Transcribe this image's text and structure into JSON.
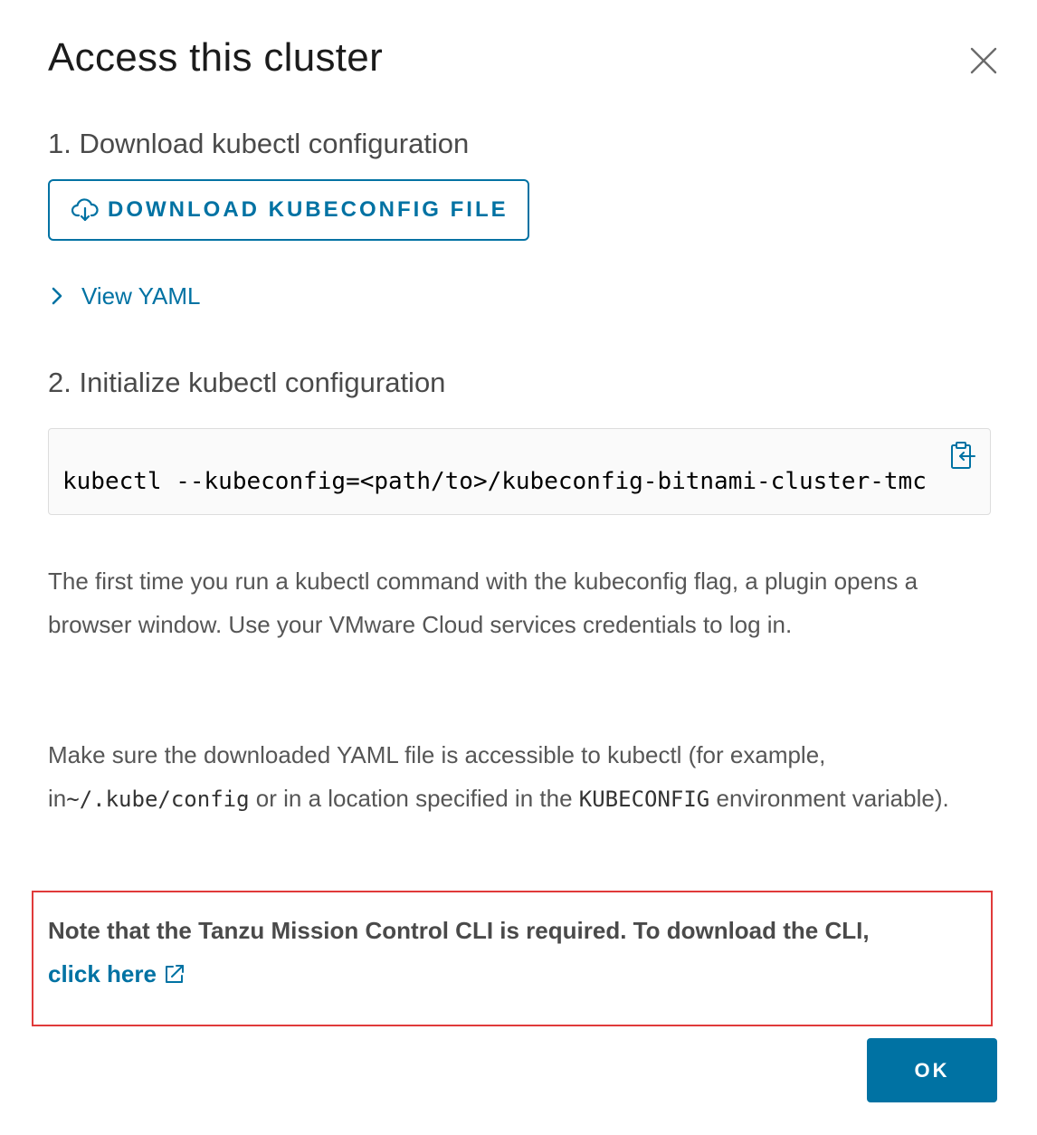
{
  "dialog": {
    "title": "Access this cluster",
    "close_icon": "close-icon"
  },
  "step1": {
    "heading": "1. Download kubectl configuration",
    "download_button": {
      "label": "DOWNLOAD KUBECONFIG FILE",
      "icon": "cloud-download-icon"
    },
    "view_yaml": {
      "label": "View YAML",
      "icon": "chevron-right-icon"
    }
  },
  "step2": {
    "heading": "2. Initialize kubectl configuration",
    "command": "kubectl --kubeconfig=<path/to>/kubeconfig-bitnami-cluster-tmc",
    "copy_icon": "copy-to-clipboard-icon"
  },
  "info": {
    "paragraph1": "The first time you run a kubectl command with the kubeconfig flag, a plugin opens a browser window. Use your VMware Cloud services credentials to log in.",
    "paragraph2": {
      "text_before": "Make sure the downloaded YAML file is accessible to kubectl (for example, in",
      "code_path": "~/.kube/config",
      "text_middle": " or in a location specified in the ",
      "code_env": "KUBECONFIG",
      "text_after": " environment variable)."
    }
  },
  "note": {
    "text": "Note that the Tanzu Mission Control CLI is required. To download the CLI,",
    "link_label": "click here",
    "link_icon": "external-link-icon"
  },
  "footer": {
    "ok_label": "OK"
  },
  "colors": {
    "accent": "#0072a3",
    "highlight_border": "#e03a3a",
    "title_text": "#1b1b1b",
    "body_text": "#565656"
  }
}
